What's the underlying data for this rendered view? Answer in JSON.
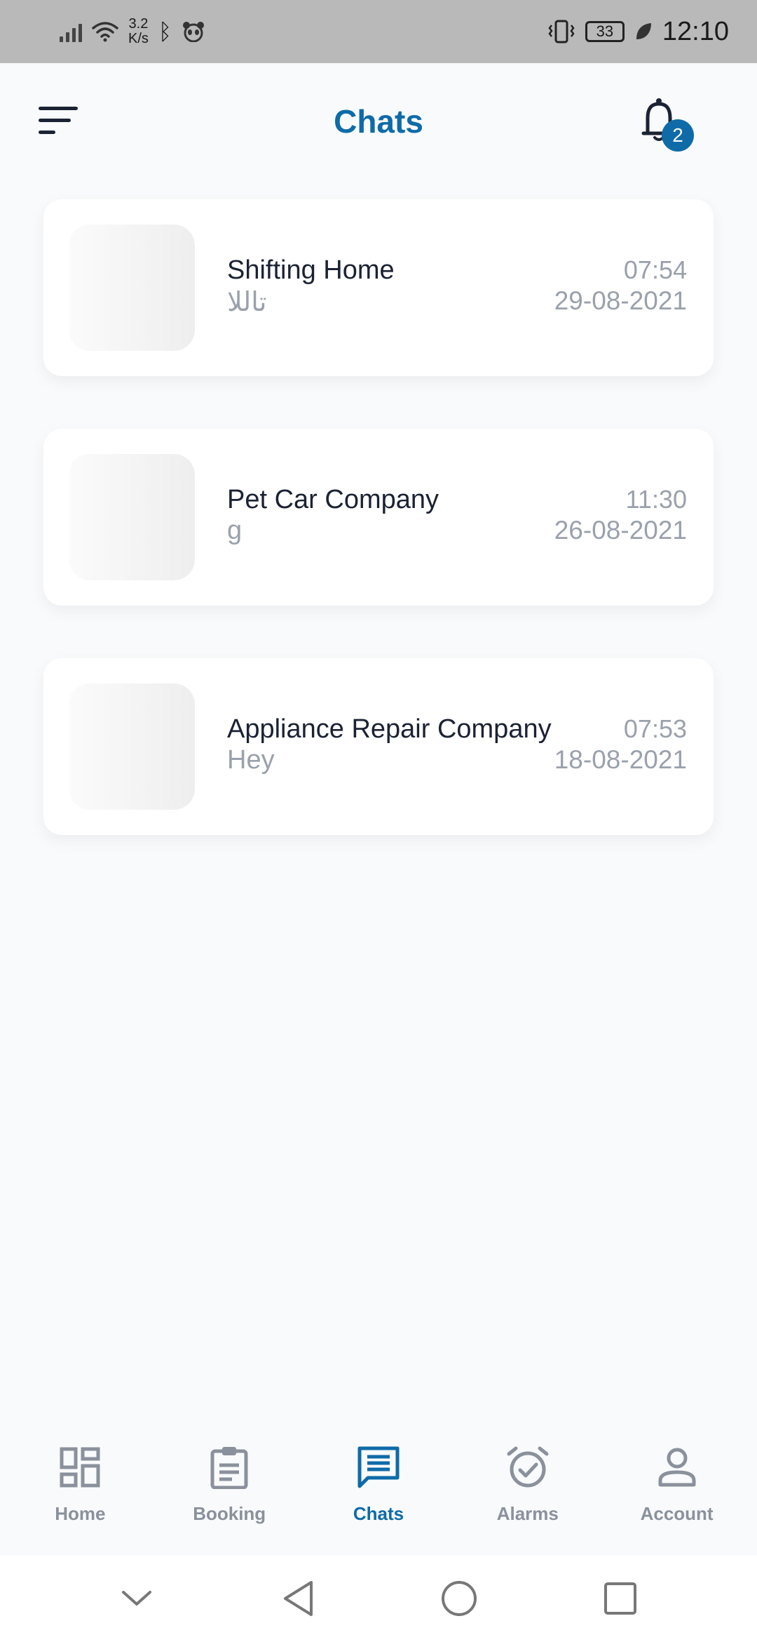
{
  "status_bar": {
    "net_speed_value": "3.2",
    "net_speed_unit": "K/s",
    "battery": "33",
    "time": "12:10"
  },
  "header": {
    "title": "Chats",
    "notification_count": "2"
  },
  "chats": [
    {
      "name": "Shifting Home",
      "preview": "تاللا",
      "time": "07:54",
      "date": "29-08-2021"
    },
    {
      "name": "Pet Car Company",
      "preview": "g",
      "time": "11:30",
      "date": "26-08-2021"
    },
    {
      "name": "Appliance Repair Company",
      "preview": "Hey",
      "time": "07:53",
      "date": "18-08-2021"
    }
  ],
  "tabs": [
    {
      "label": "Home",
      "icon": "dashboard-icon",
      "active": false
    },
    {
      "label": "Booking",
      "icon": "clipboard-icon",
      "active": false
    },
    {
      "label": "Chats",
      "icon": "chat-icon",
      "active": true
    },
    {
      "label": "Alarms",
      "icon": "alarm-clock-icon",
      "active": false
    },
    {
      "label": "Account",
      "icon": "person-icon",
      "active": false
    }
  ],
  "colors": {
    "accent": "#0e6ba8",
    "text_primary": "#1b2233",
    "text_muted": "#9aa1ac",
    "tab_inactive": "#8a919c",
    "background": "#f9fafb"
  }
}
